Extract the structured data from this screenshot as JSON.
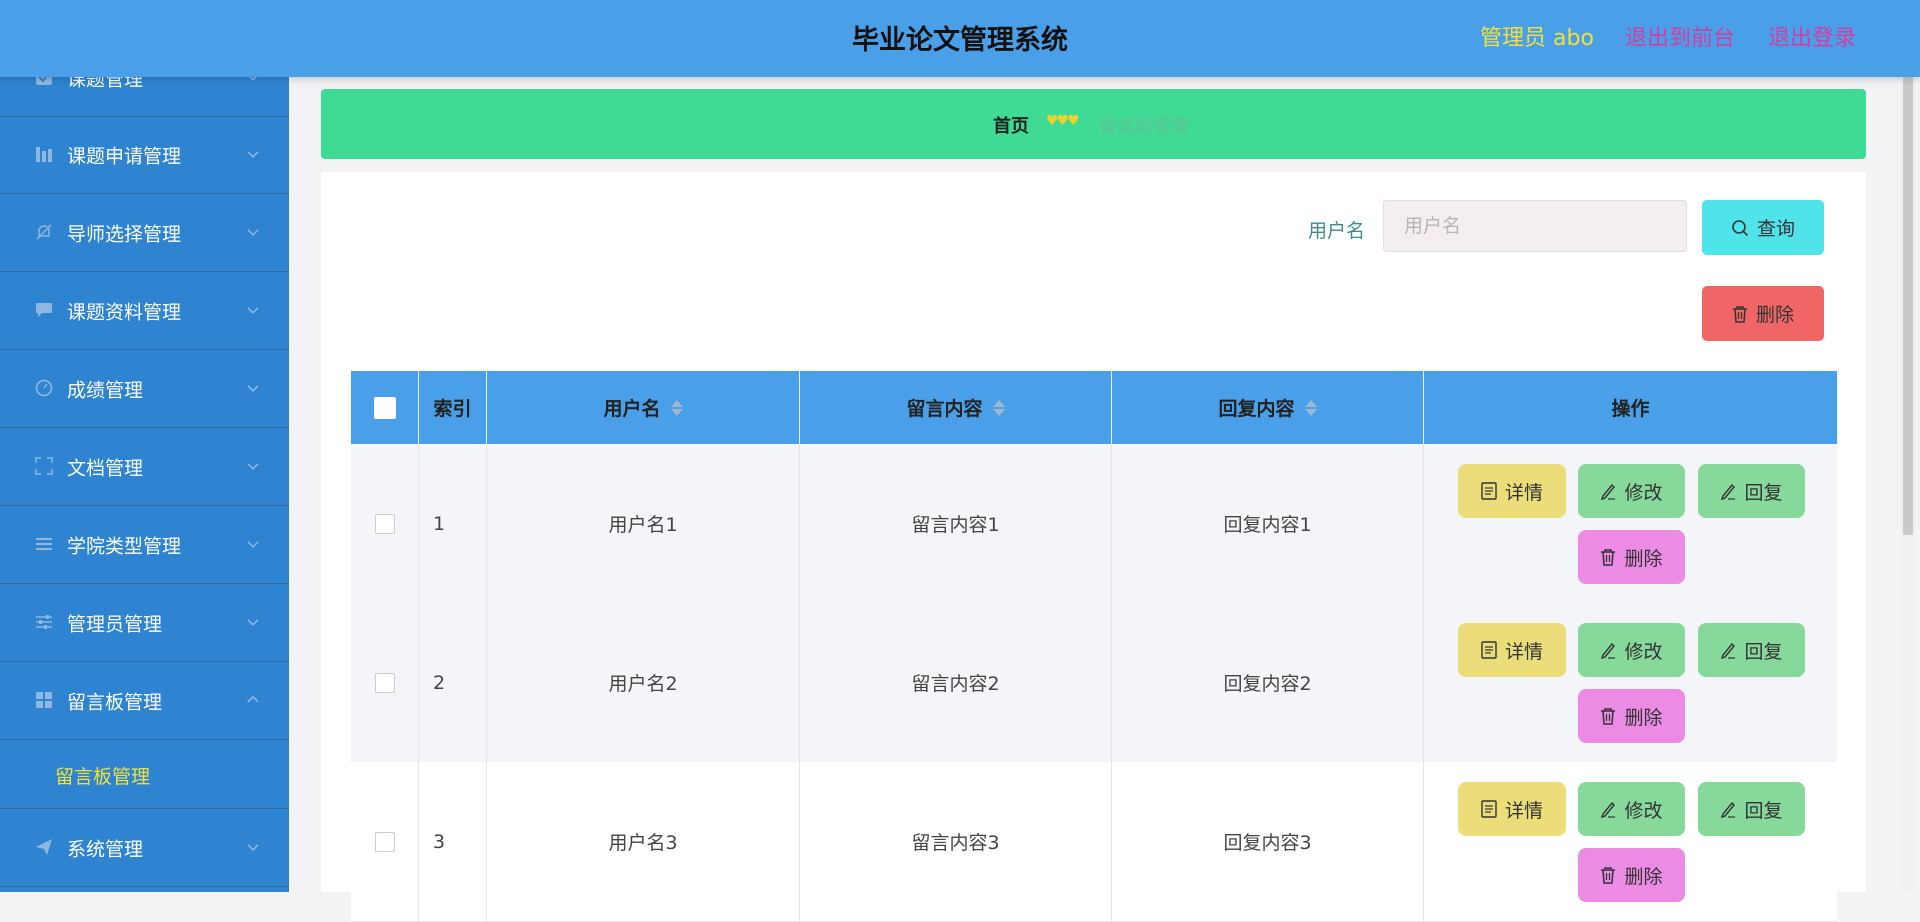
{
  "header": {
    "title": "毕业论文管理系统",
    "admin": "管理员 abo",
    "exit_front": "退出到前台",
    "logout": "退出登录"
  },
  "sidebar": {
    "items": [
      {
        "label": "课题管理",
        "icon": "checkbox-icon"
      },
      {
        "label": "课题申请管理",
        "icon": "bar-chart-icon"
      },
      {
        "label": "导师选择管理",
        "icon": "bell-off-icon"
      },
      {
        "label": "课题资料管理",
        "icon": "chat-icon"
      },
      {
        "label": "成绩管理",
        "icon": "gauge-icon"
      },
      {
        "label": "文档管理",
        "icon": "fullscreen-icon"
      },
      {
        "label": "学院类型管理",
        "icon": "list-icon"
      },
      {
        "label": "管理员管理",
        "icon": "sliders-icon"
      },
      {
        "label": "留言板管理",
        "icon": "grid-icon"
      },
      {
        "label": "系统管理",
        "icon": "paper-plane-icon"
      }
    ],
    "sub_item": "留言板管理"
  },
  "breadcrumb": {
    "home": "首页",
    "separator": "♥♥♥",
    "current": "留言板管理"
  },
  "search": {
    "label": "用户名",
    "placeholder": "用户名",
    "query_button": "查询",
    "delete_button": "删除"
  },
  "table": {
    "columns": [
      "索引",
      "用户名",
      "留言内容",
      "回复内容",
      "操作"
    ],
    "rows": [
      {
        "index": "1",
        "username": "用户名1",
        "message": "留言内容1",
        "reply": "回复内容1"
      },
      {
        "index": "2",
        "username": "用户名2",
        "message": "留言内容2",
        "reply": "回复内容2"
      },
      {
        "index": "3",
        "username": "用户名3",
        "message": "留言内容3",
        "reply": "回复内容3"
      }
    ],
    "actions": {
      "detail": "详情",
      "edit": "修改",
      "reply": "回复",
      "delete": "删除"
    }
  },
  "colors": {
    "header_bg": "#4aa0e8",
    "sidebar_bg": "#2e84d1",
    "breadcrumb_bg": "#3fdb94",
    "accent_yellow": "#f3e13a",
    "accent_magenta": "#d23ea2"
  }
}
